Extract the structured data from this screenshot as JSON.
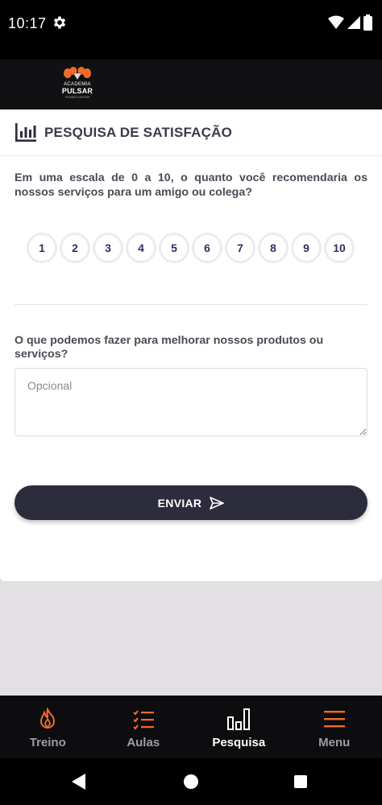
{
  "status_bar": {
    "time": "10:17",
    "icons": [
      "gear-icon",
      "wifi-icon",
      "signal-icon",
      "battery-icon"
    ]
  },
  "header": {
    "logo": {
      "line1": "ACADEMIA",
      "line2": "PULSAR",
      "line3": "FITNESS CENTER"
    }
  },
  "survey": {
    "title": "PESQUISA DE SATISFAÇÃO",
    "title_icon": "bar-chart-icon",
    "question1": "Em uma escala de 0 a 10, o quanto você recomendaria os nossos serviços para um amigo ou colega?",
    "scale": [
      "1",
      "2",
      "3",
      "4",
      "5",
      "6",
      "7",
      "8",
      "9",
      "10"
    ],
    "question2": "O que podemos fazer para melhorar nossos produtos ou serviços?",
    "textarea_placeholder": "Opcional",
    "textarea_value": "",
    "submit_label": "ENVIAR",
    "submit_icon": "send-icon"
  },
  "bottom_nav": {
    "items": [
      {
        "label": "Treino",
        "icon": "flame-icon",
        "active": false
      },
      {
        "label": "Aulas",
        "icon": "checklist-icon",
        "active": false
      },
      {
        "label": "Pesquisa",
        "icon": "bar-chart-icon",
        "active": true
      },
      {
        "label": "Menu",
        "icon": "hamburger-icon",
        "active": false
      }
    ]
  },
  "colors": {
    "accent": "#f26b2a",
    "dark": "#2d2c3c",
    "scale_text": "#2f3160"
  }
}
